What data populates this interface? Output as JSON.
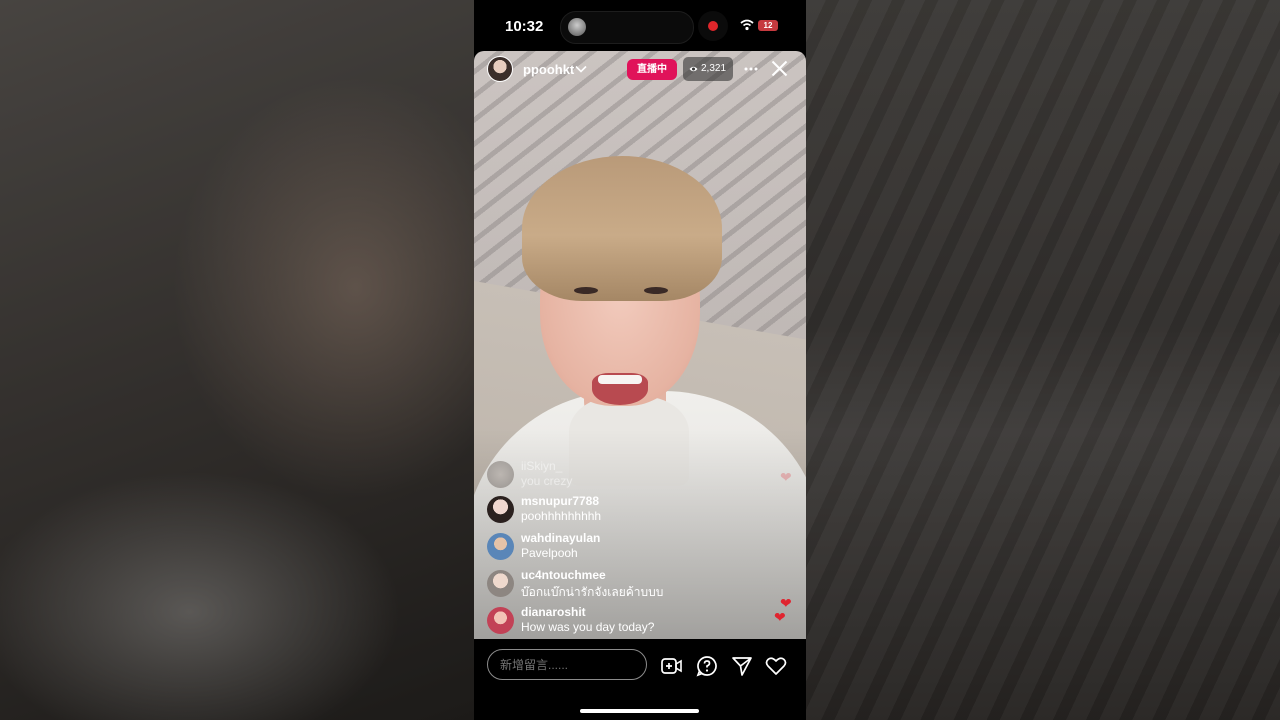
{
  "status": {
    "time": "10:32",
    "battery": "12"
  },
  "live": {
    "host": "ppoohkt",
    "badge": "直播中",
    "viewers": "2,321"
  },
  "comments": [
    {
      "user": "iiSkiyn_",
      "text": "you crezy",
      "faded": true
    },
    {
      "user": "msnupur7788",
      "text": "poohhhhhhhhh"
    },
    {
      "user": "wahdinayulan",
      "text": "Pavelpooh"
    },
    {
      "user": "uc4ntouchmee",
      "text": "บ๊อกแบ๊กน่ารักจังเลยค้าบบบ"
    },
    {
      "user": "dianaroshit",
      "text": "How was you day today?"
    }
  ],
  "bottom": {
    "comment_placeholder": "新增留言......"
  },
  "colors": {
    "live_badge": "#e0135a",
    "heart": "#e0242f",
    "record": "#e0262b"
  },
  "icons": [
    "wifi-icon",
    "chevron-down-icon",
    "eye-icon",
    "more-icon",
    "close-icon",
    "add-guest-icon",
    "question-icon",
    "send-icon",
    "heart-icon"
  ]
}
